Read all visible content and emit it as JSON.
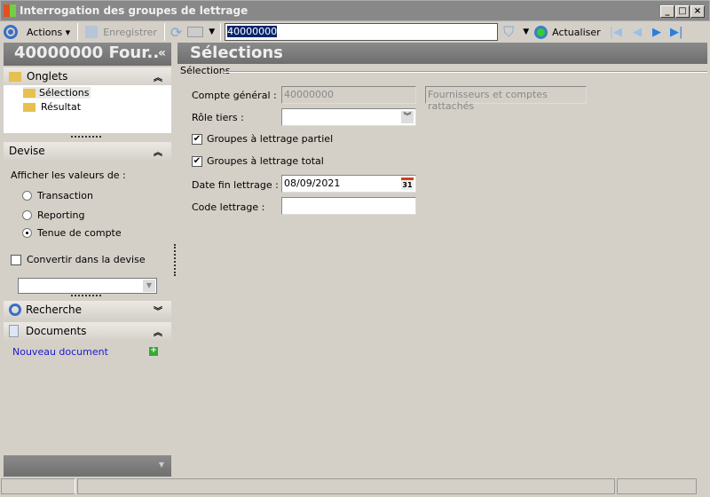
{
  "window": {
    "title": "Interrogation des groupes de lettrage"
  },
  "toolbar": {
    "actions": "Actions",
    "save": "Enregistrer",
    "search_value": "40000000",
    "refresh": "Actualiser"
  },
  "left": {
    "header": "40000000 Four..",
    "onglets": "Onglets",
    "tree": [
      "Sélections",
      "Résultat"
    ],
    "devise": "Devise",
    "afficher": "Afficher les valeurs de :",
    "radios": [
      {
        "label": "Transaction",
        "checked": false
      },
      {
        "label": "Reporting",
        "checked": false
      },
      {
        "label": "Tenue de compte",
        "checked": true
      }
    ],
    "convertir": "Convertir dans la devise",
    "convertir_checked": false,
    "recherche": "Recherche",
    "documents": "Documents",
    "nouveau": "Nouveau document"
  },
  "main": {
    "header": "Sélections",
    "group": "Sélections",
    "compte_label": "Compte général :",
    "compte_value": "40000000",
    "compte_desc": "Fournisseurs et comptes rattachés",
    "role_label": "Rôle tiers :",
    "role_value": "",
    "partiel_label": "Groupes à lettrage partiel",
    "partiel_checked": true,
    "total_label": "Groupes à lettrage total",
    "total_checked": true,
    "date_label": "Date fin lettrage :",
    "date_value": "08/09/2021",
    "code_label": "Code lettrage :",
    "code_value": ""
  }
}
